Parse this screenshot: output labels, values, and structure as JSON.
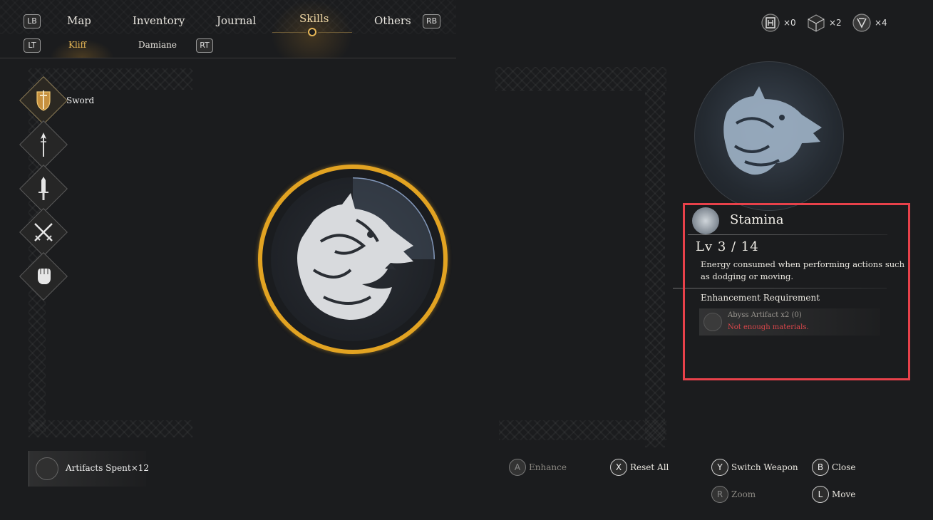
{
  "nav": {
    "lb": "LB",
    "rb": "RB",
    "lt": "LT",
    "rt": "RT",
    "tabs": [
      "Map",
      "Inventory",
      "Journal",
      "Skills",
      "Others"
    ],
    "active_tab": "Skills",
    "subtabs": [
      "Kliff",
      "Damiane"
    ],
    "active_subtab": "Kliff"
  },
  "currencies": [
    {
      "icon": "artifact-icon",
      "count": "×0"
    },
    {
      "icon": "cube-icon",
      "count": "×2"
    },
    {
      "icon": "shield-emblem-icon",
      "count": "×4"
    }
  ],
  "weapons": {
    "active_label": "Sword",
    "items": [
      "shield-sword-icon",
      "spear-icon",
      "dagger-icon",
      "crossed-swords-icon",
      "fist-icon"
    ]
  },
  "center_skill": {
    "icon": "wolf-emblem-icon"
  },
  "panel": {
    "title": "Stamina",
    "level": "Lv 3 / 14",
    "description": "Energy consumed when performing actions such as dodging or moving.",
    "requirement_title": "Enhancement Requirement",
    "requirement_item": "Abyss Artifact x2 (0)",
    "requirement_warning": "Not enough materials."
  },
  "footer": {
    "spent_label": "Artifacts Spent×12",
    "hints": [
      {
        "button": "A",
        "label": "Enhance"
      },
      {
        "button": "X",
        "label": "Reset All"
      },
      {
        "button": "Y",
        "label": "Switch Weapon"
      },
      {
        "button": "B",
        "label": "Close"
      },
      {
        "button": "R",
        "label": "Zoom"
      },
      {
        "button": "L",
        "label": "Move"
      }
    ]
  },
  "colors": {
    "accent_gold": "#e2a322",
    "highlight_red": "#e8414a",
    "warning_red": "#d9464a"
  }
}
